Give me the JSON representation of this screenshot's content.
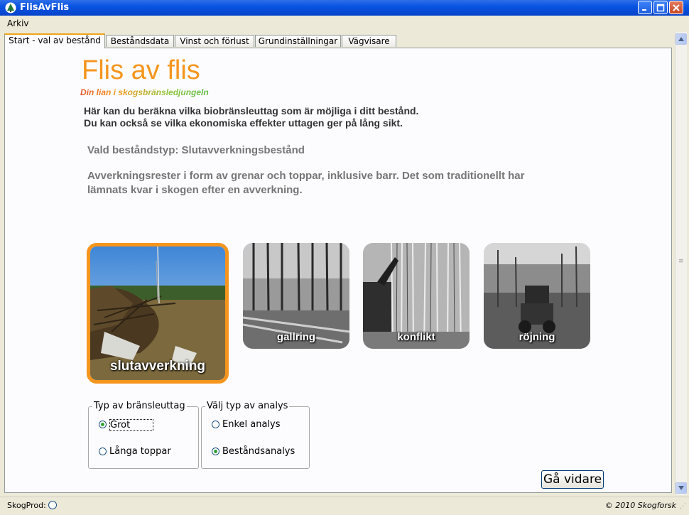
{
  "window": {
    "title": "FlisAvFlis"
  },
  "menu": {
    "items": [
      {
        "label": "Arkiv"
      }
    ]
  },
  "tabs": [
    {
      "label": "Start - val av bestånd",
      "active": true
    },
    {
      "label": "Beståndsdata",
      "active": false
    },
    {
      "label": "Vinst och förlust",
      "active": false
    },
    {
      "label": "Grundinställningar",
      "active": false
    },
    {
      "label": "Vägvisare",
      "active": false
    }
  ],
  "brand": {
    "title": "Flis av flis",
    "tagline": "Din lian i skogsbränsledjungeln",
    "title_color": "#F5951D"
  },
  "intro": {
    "line1": "Här kan du beräkna vilka biobränsleuttag som är möjliga i ditt bestånd.",
    "line2": "Du kan också se vilka ekonomiska effekter uttagen ger på lång sikt."
  },
  "selected_stand": {
    "label": "Vald beståndstyp: Slutavverkningsbestånd",
    "description": "Avverkningsrester i form av grenar och toppar, inklusive barr. Det som traditionellt har lämnats kvar i skogen efter en avverkning."
  },
  "stand_types": [
    {
      "label": "slutavverkning",
      "selected": true
    },
    {
      "label": "gallring",
      "selected": false
    },
    {
      "label": "konflikt",
      "selected": false
    },
    {
      "label": "röjning",
      "selected": false
    }
  ],
  "fuel_type_group": {
    "title": "Typ av bränsleuttag",
    "options": [
      {
        "label": "Grot",
        "checked": true
      },
      {
        "label": "Långa toppar",
        "checked": false
      }
    ]
  },
  "analysis_group": {
    "title": "Välj typ av analys",
    "options": [
      {
        "label": "Enkel analys",
        "checked": false
      },
      {
        "label": "Beståndsanalys",
        "checked": true
      }
    ]
  },
  "actions": {
    "continue_label": "Gå vidare"
  },
  "status": {
    "label": "SkogProd:",
    "copyright": "© 2010 Skogforsk"
  }
}
